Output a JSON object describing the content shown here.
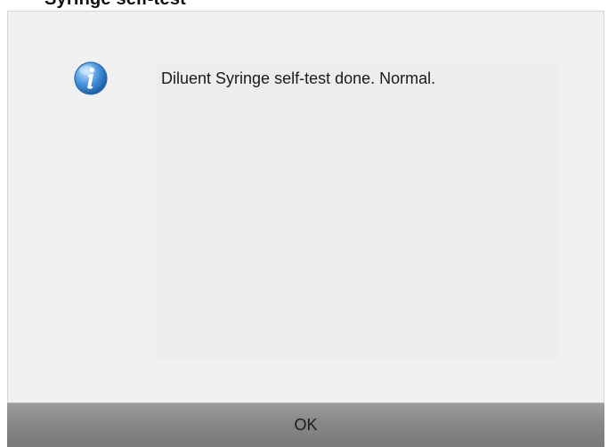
{
  "window_title_partial": "Syringe self-test",
  "dialog": {
    "icon": "info-icon",
    "message": "Diluent Syringe self-test done. Normal.",
    "ok_label": "OK"
  },
  "colors": {
    "dialog_background": "#f0f0f0",
    "message_panel": "#ededed",
    "button_gray": "#878787",
    "icon_blue": "#2f7fc8"
  }
}
